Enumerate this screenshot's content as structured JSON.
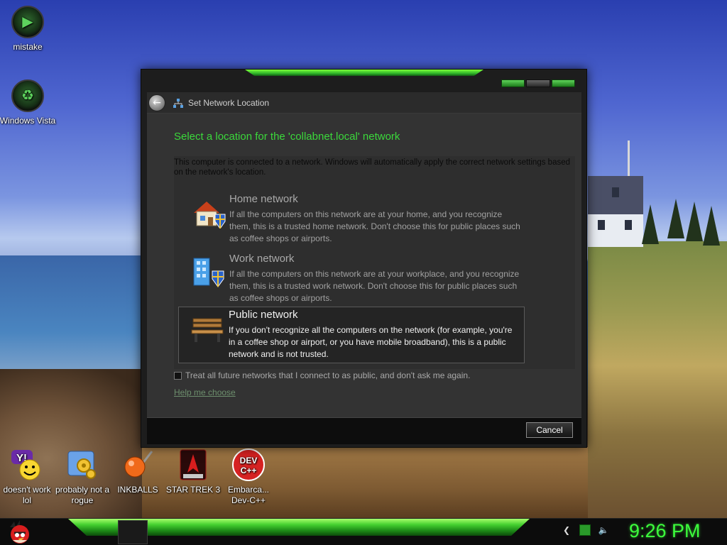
{
  "desktop": {
    "icons": [
      {
        "label": "mistake",
        "icon": "green-orb-icon"
      },
      {
        "label": "Windows Vista",
        "icon": "recycle-bin-icon"
      },
      {
        "label": "doesn't work lol",
        "icon": "yahoo-messenger-icon"
      },
      {
        "label": "probably not a rogue",
        "icon": "settings-gears-icon"
      },
      {
        "label": "INKBALLS",
        "icon": "inkball-icon"
      },
      {
        "label": "STAR TREK 3",
        "icon": "star-trek-icon"
      },
      {
        "label": "Embarca... Dev-C++",
        "icon": "dev-cpp-icon"
      }
    ],
    "devcpp_badge": "DEV C++"
  },
  "dialog": {
    "nav_title": "Set Network Location",
    "heading": "Select a location for the 'collabnet.local' network",
    "intro": "This computer is connected to a network. Windows will automatically apply the correct network settings based on the network's location.",
    "options": [
      {
        "title": "Home network",
        "description": "If all the computers on this network are at your home, and you recognize them, this is a trusted home network.  Don't choose this for public places such as coffee shops or airports.",
        "icon": "home-network-icon",
        "selected": false
      },
      {
        "title": "Work network",
        "description": "If all the computers on this network are at your workplace, and you recognize them, this is a trusted work network.  Don't choose this for public places such as coffee shops or airports.",
        "icon": "work-network-icon",
        "selected": false
      },
      {
        "title": "Public network",
        "description": "If you don't recognize all the computers on the network (for example, you're in a coffee shop or airport, or you have mobile broadband), this is a public network and is not trusted.",
        "icon": "public-network-bench-icon",
        "selected": true
      }
    ],
    "checkbox_label": "Treat all future networks that I connect to as public, and don't ask me again.",
    "checkbox_checked": false,
    "help_link": "Help me choose",
    "cancel_label": "Cancel"
  },
  "taskbar": {
    "clock": "9:26 PM",
    "tray_icons": [
      "show-hidden-icon",
      "network-icon",
      "volume-icon"
    ]
  },
  "colors": {
    "accent_green": "#3bd83b",
    "clock_green": "#3cff3c",
    "dialog_bg": "#333333"
  }
}
